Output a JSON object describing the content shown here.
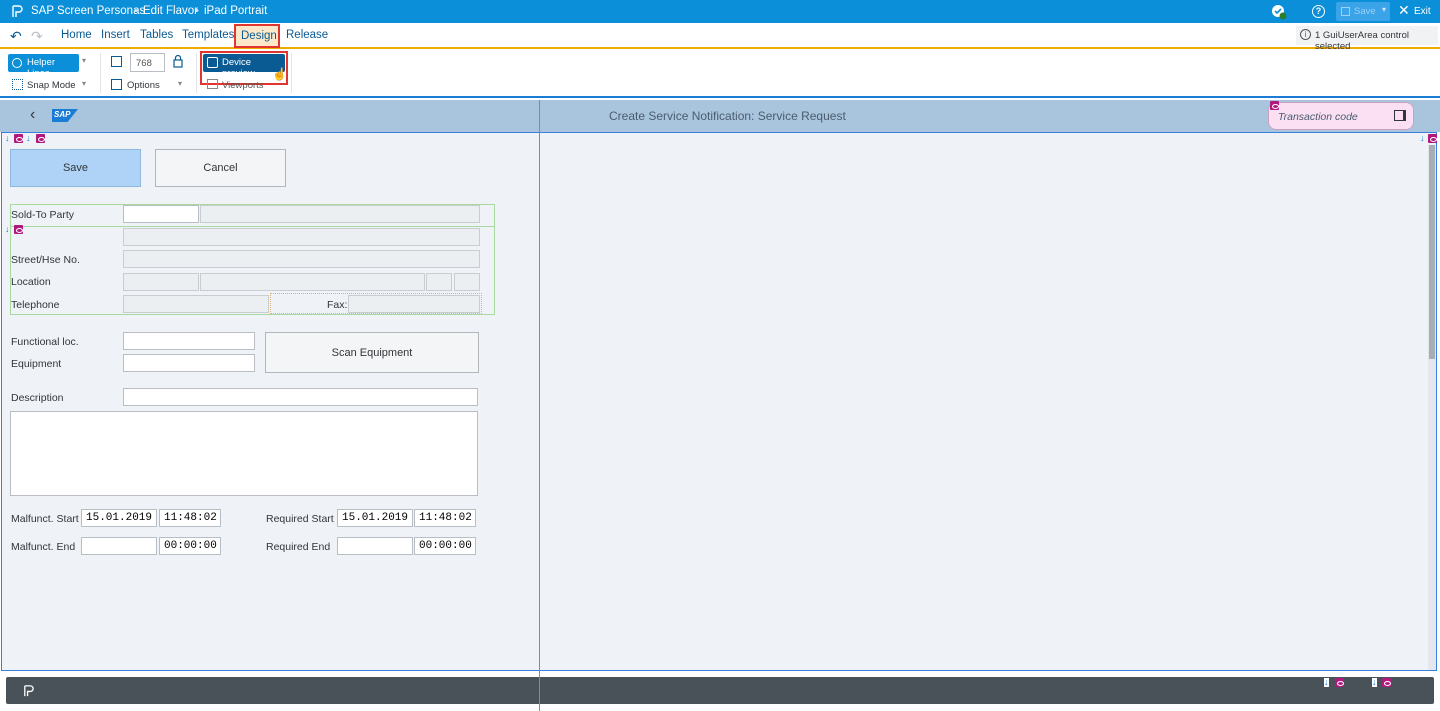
{
  "title_bar": {
    "app": "SAP Screen Personas",
    "mode": "Edit Flavor",
    "flavor": "iPad Portrait",
    "save_label": "Save",
    "exit_label": "Exit"
  },
  "menu": {
    "items": [
      "Home",
      "Insert",
      "Tables",
      "Templates",
      "Design",
      "Release"
    ],
    "active": "Design",
    "status": "1 GuiUserArea control selected"
  },
  "ribbon": {
    "helper_lines": "Helper Lines",
    "snap_mode": "Snap Mode",
    "width_value": "768",
    "options": "Options",
    "device_preview": "Device preview",
    "viewports": "Viewports"
  },
  "header": {
    "logo": "SAP",
    "title": "Create Service Notification: Service Request",
    "transaction_placeholder": "Transaction code"
  },
  "form": {
    "save": "Save",
    "cancel": "Cancel",
    "sold_to_party": "Sold-To Party",
    "street": "Street/Hse No.",
    "location": "Location",
    "telephone": "Telephone",
    "fax": "Fax:",
    "functional_loc": "Functional loc.",
    "equipment": "Equipment",
    "scan_equipment": "Scan Equipment",
    "description": "Description",
    "malf_start": "Malfunct. Start",
    "malf_start_date": "15.01.2019",
    "malf_start_time": "11:48:02",
    "malf_end": "Malfunct. End",
    "malf_end_date": "",
    "malf_end_time": "00:00:00",
    "req_start": "Required Start",
    "req_start_date": "15.01.2019",
    "req_start_time": "11:48:02",
    "req_end": "Required End",
    "req_end_date": "",
    "req_end_time": "00:00:00"
  },
  "colors": {
    "title_bar": "#0a8fd8",
    "accent_border": "#f0ab00",
    "highlight_red": "#e0362f",
    "selection_blue": "#3b7fde",
    "guide_line": "#c858e0"
  }
}
